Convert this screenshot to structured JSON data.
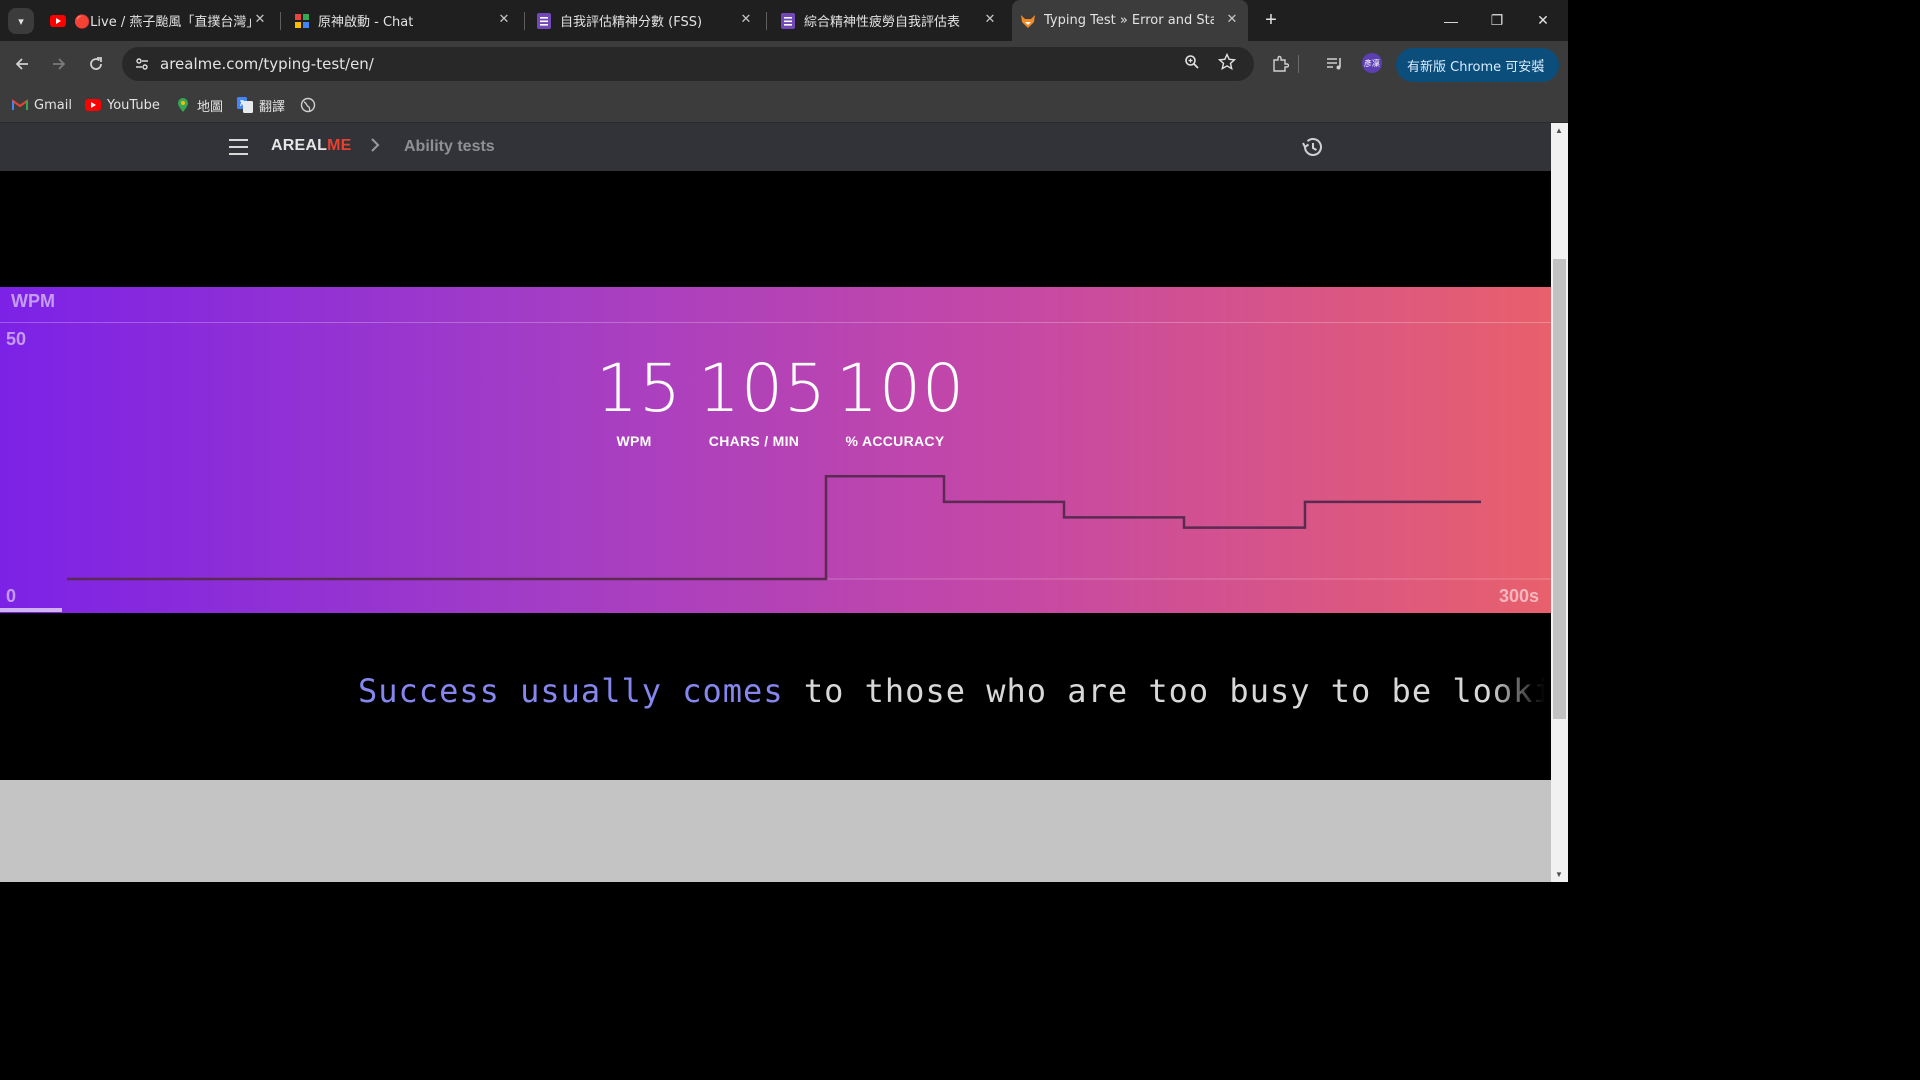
{
  "browser": {
    "tabs": [
      {
        "title": "🔴Live / 燕子颱風「直撲台灣」",
        "icon": "youtube-icon"
      },
      {
        "title": "原神啟動 - Chat",
        "icon": "chat-icon"
      },
      {
        "title": "自我評估精神分數 (FSS)",
        "icon": "forms-icon"
      },
      {
        "title": "綜合精神性疲勞自我評估表",
        "icon": "forms-icon"
      },
      {
        "title": "Typing Test » Error and Statisti",
        "icon": "fox-icon",
        "active": true
      }
    ],
    "url": "arealme.com/typing-test/en/",
    "update_button": "有新版 Chrome 可安裝",
    "avatar_text": "彥凜",
    "bookmarks": [
      {
        "label": "Gmail",
        "icon": "gmail-icon"
      },
      {
        "label": "YouTube",
        "icon": "youtube-icon"
      },
      {
        "label": "地圖",
        "icon": "maps-icon"
      },
      {
        "label": "翻譯",
        "icon": "translate-icon"
      },
      {
        "label": "",
        "icon": "globe-icon"
      }
    ]
  },
  "site": {
    "logo_main": "AREAL",
    "logo_accent": "ME",
    "breadcrumb": "Ability tests"
  },
  "results": {
    "axis_label": "WPM",
    "y_max_label": "50",
    "y_min_label": "0",
    "x_max_label": "300s",
    "stats": [
      {
        "value": "15",
        "label": "WPM"
      },
      {
        "value": "105",
        "label": "CHARS / MIN"
      },
      {
        "value": "100",
        "label": "% ACCURACY"
      }
    ],
    "progress_fraction": 0.04
  },
  "chart_data": {
    "type": "line",
    "title": "",
    "xlabel": "",
    "ylabel": "WPM",
    "xlim": [
      0,
      300
    ],
    "ylim": [
      0,
      50
    ],
    "x_tick_labels": [
      "300s"
    ],
    "y_tick_labels": [
      "50",
      "0"
    ],
    "x": [
      0,
      10,
      20,
      30,
      40,
      50,
      60,
      70,
      80
    ],
    "series": [
      {
        "values": [
          0,
          0,
          0,
          0,
          0,
          0,
          0,
          20,
          15,
          12,
          10,
          15,
          15
        ]
      }
    ],
    "line_color": "#5a2a52"
  },
  "quote": {
    "typed": "Success usually comes",
    "remaining": " to those who are too busy to be looking for it."
  },
  "colors": {
    "accent_logo": "#e8402f",
    "typed_text": "#8587ef",
    "gradient_start": "#7c22e6",
    "gradient_end": "#e8606c"
  }
}
